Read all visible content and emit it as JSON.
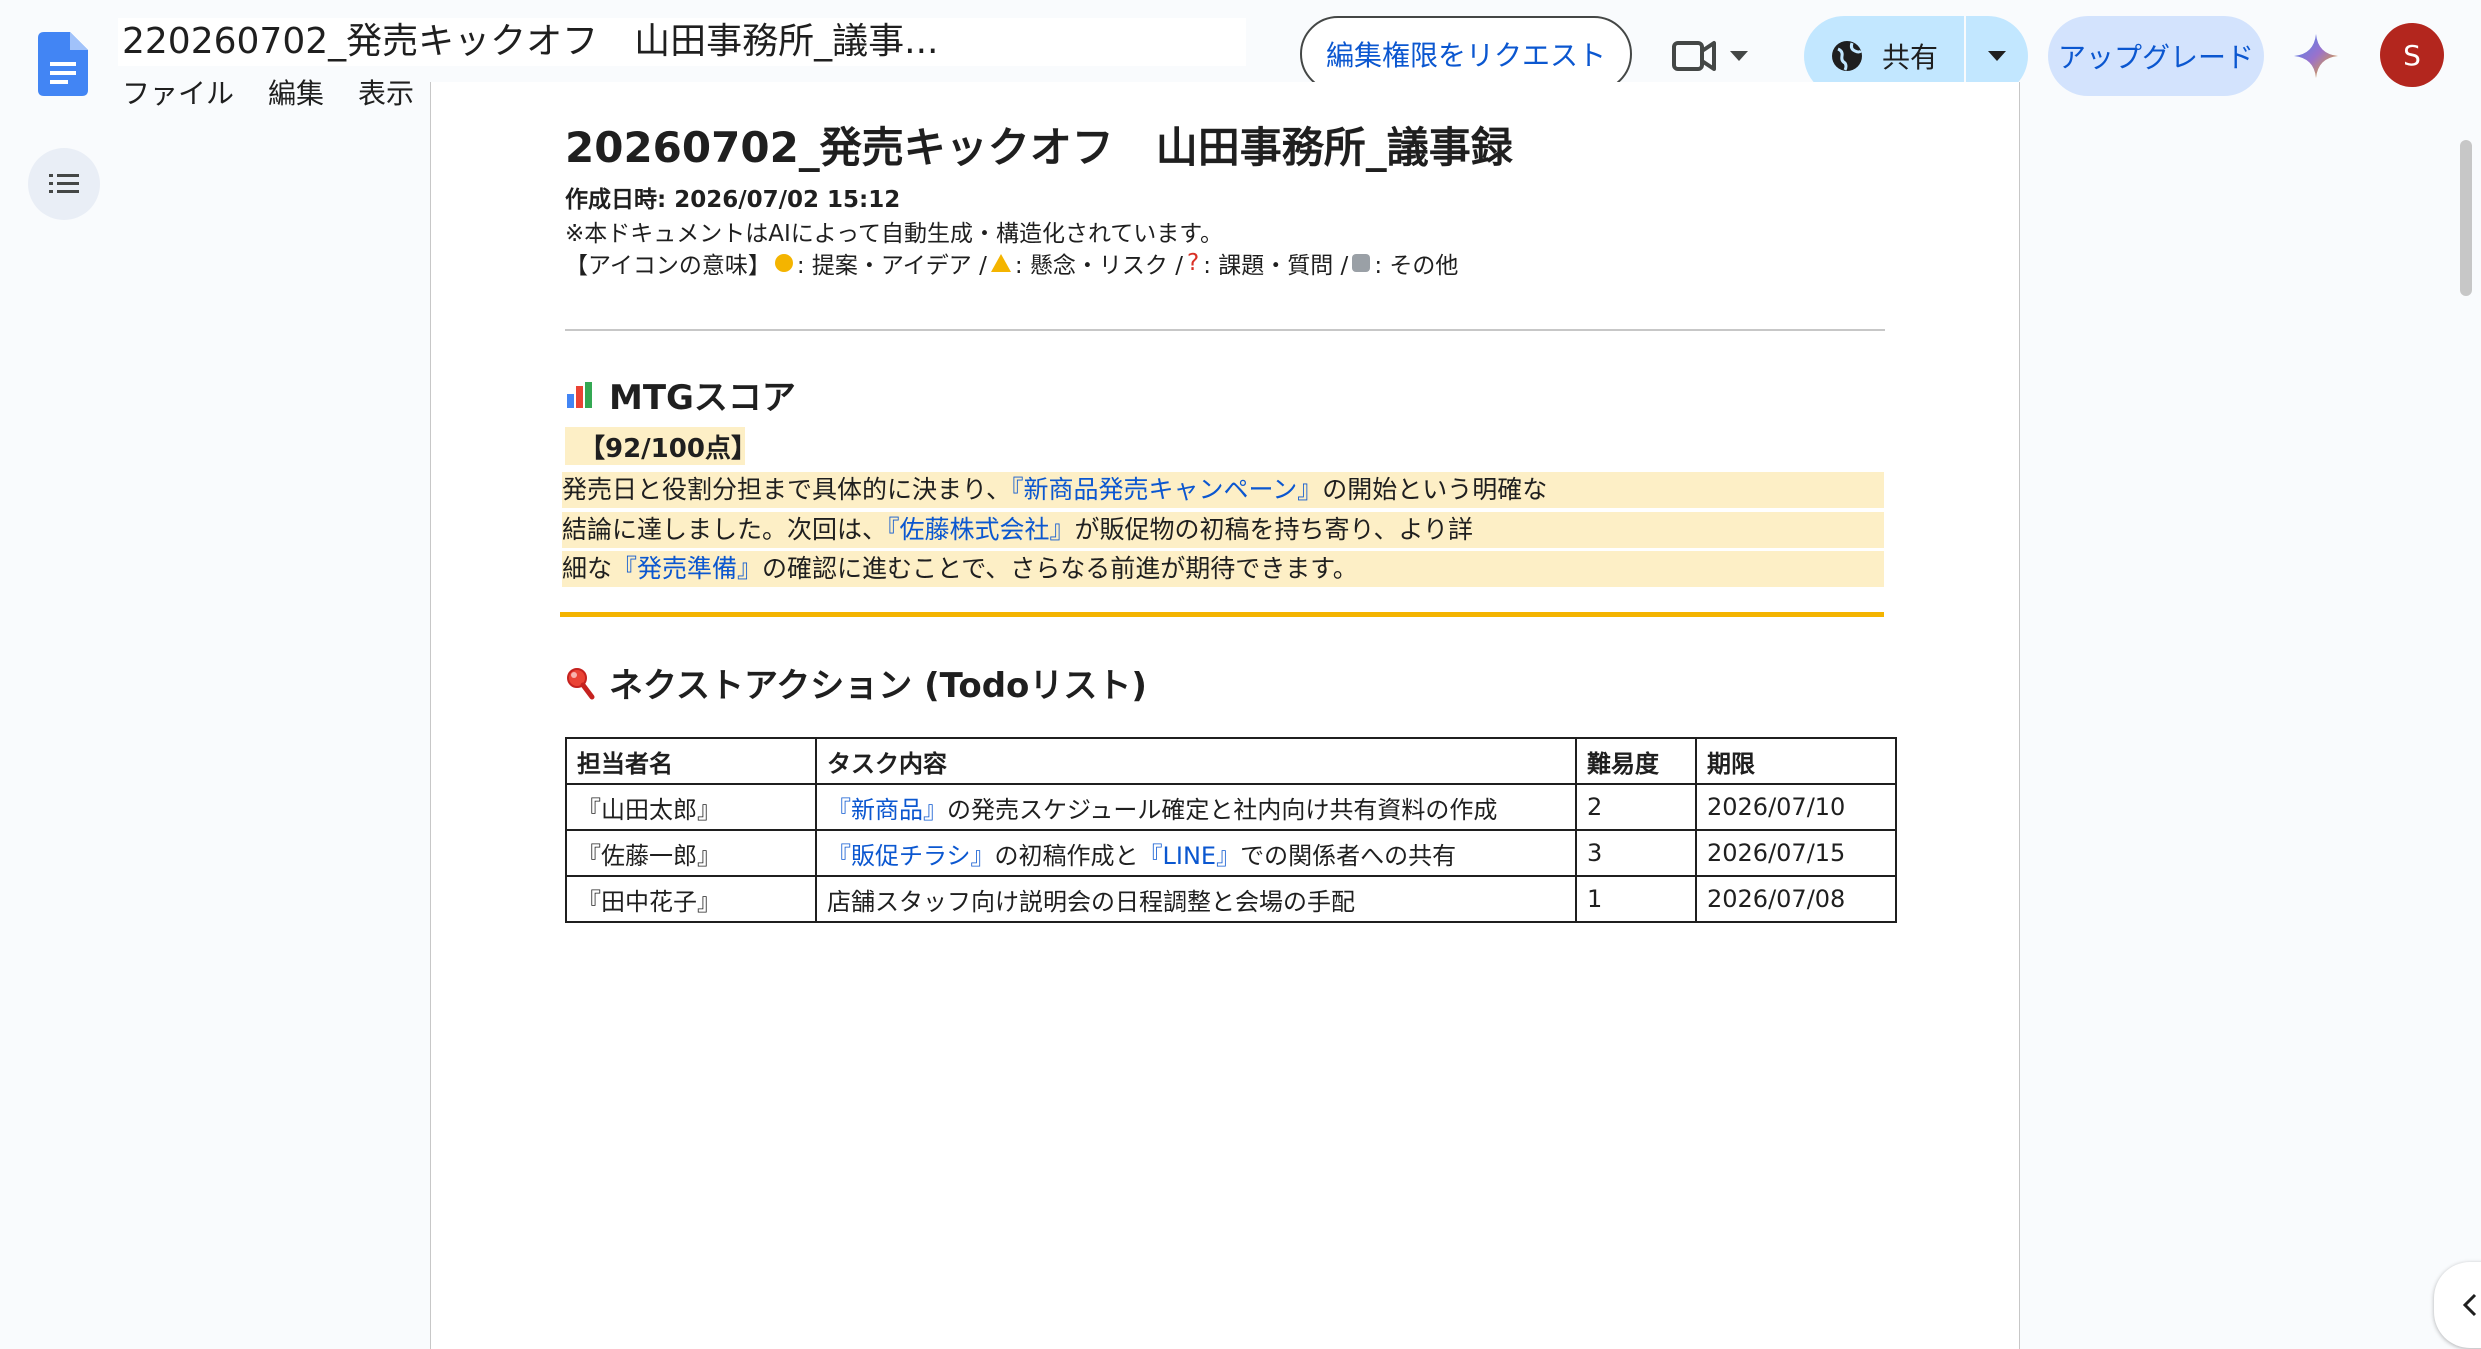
{
  "header": {
    "title_prefix": "2",
    "title": "20260702_発売キックオフ　山田事務所_議事...",
    "menu": [
      "ファイル",
      "編集",
      "表示"
    ],
    "request_edit_label": "編集権限をリクエスト",
    "share_label": "共有",
    "upgrade_label": "アップグレード",
    "avatar_initial": "S"
  },
  "doc": {
    "title": "20260702_発売キックオフ　山田事務所_議事録",
    "created": "作成日時: 2026/07/02 15:12",
    "ai_note": "※本ドキュメントはAIによって自動生成・構造化されています。",
    "legend_prefix": "【アイコンの意味】",
    "legend_idea": ": 提案・アイデア /",
    "legend_risk": ": 懸念・リスク /",
    "legend_q_mark": "?",
    "legend_question": ": 課題・質問 /",
    "legend_other": ": その他",
    "score_heading": "MTGスコア",
    "score_value": "【92/100点】",
    "score_l1_a": "発売日と役割分担まで具体的に決まり、",
    "score_l1_link": "『新商品発売キャンペーン』",
    "score_l1_b": "の開始という明確な",
    "score_l2_a": "結論に達しました。次回は、",
    "score_l2_link": "『佐藤株式会社』",
    "score_l2_b": "が販促物の初稿を持ち寄り、より詳",
    "score_l3_a": "細な",
    "score_l3_link": "『発売準備』",
    "score_l3_b": "の確認に進むことで、さらなる前進が期待できます。",
    "todo_heading": "ネクストアクション (Todoリスト)",
    "table": {
      "headers": [
        "担当者名",
        "タスク内容",
        "難易度",
        "期限"
      ],
      "rows": [
        {
          "owner": "『山田太郎』",
          "task_link": "『新商品』",
          "task_text": "の発売スケジュール確定と社内向け共有資料の作成",
          "level": "2",
          "due": "2026/07/10"
        },
        {
          "owner": "『佐藤一郎』",
          "task_link": "『販促チラシ』",
          "task_mid": "の初稿作成と",
          "task_link2": "『LINE』",
          "task_text": "での関係者への共有",
          "level": "3",
          "due": "2026/07/15"
        },
        {
          "owner": "『田中花子』",
          "task_text": "店舗スタッフ向け説明会の日程調整と会場の手配",
          "level": "1",
          "due": "2026/07/08"
        }
      ]
    }
  },
  "icons": {
    "docs": "docs-icon",
    "meet": "video-camera-icon",
    "globe": "globe-icon",
    "gemini": "gemini-sparkle-icon",
    "outline": "outline-list-icon",
    "chart": "bar-chart-icon",
    "search": "search-icon"
  },
  "colors": {
    "accent": "#0b57d0",
    "highlight": "#fdefc6",
    "rule": "#f4b400",
    "avatar": "#b3261e"
  }
}
